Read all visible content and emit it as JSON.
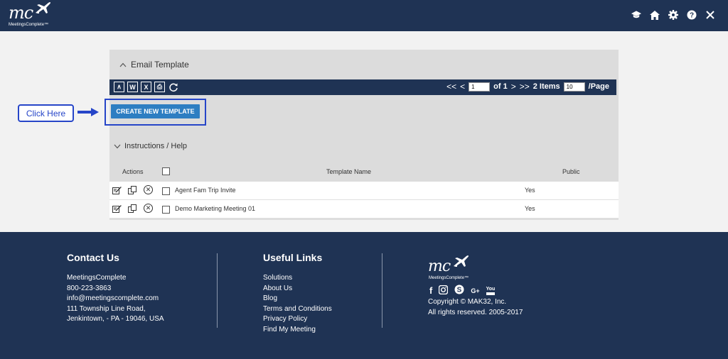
{
  "brand": {
    "logo_text": "mc",
    "logo_subtext": "MeetingsComplete™"
  },
  "header": {
    "icons": [
      "graduation-cap-icon",
      "home-icon",
      "gear-icon",
      "help-icon",
      "close-icon"
    ]
  },
  "panel": {
    "section_title": "Email Template",
    "toolbar": {
      "export_labels": {
        "pdf": "∧",
        "word": "W",
        "excel": "X",
        "print": "⎙"
      },
      "page_value": "1",
      "of_label": "of 1",
      "items_label": "2 Items",
      "per_page_value": "10",
      "per_page_label": "/Page"
    },
    "create_button": "CREATE NEW TEMPLATE",
    "instructions_label": "Instructions / Help",
    "table": {
      "headers": {
        "actions": "Actions",
        "name": "Template Name",
        "public": "Public"
      },
      "rows": [
        {
          "name": "Agent Fam Trip Invite",
          "public": "Yes"
        },
        {
          "name": "Demo Marketing Meeting 01",
          "public": "Yes"
        }
      ]
    }
  },
  "callout": {
    "label": "Click Here"
  },
  "footer": {
    "contact": {
      "title": "Contact Us",
      "lines": [
        "MeetingsComplete",
        "800-223-3863",
        "info@meetingscomplete.com",
        "111 Township Line Road,",
        "Jenkintown, - PA - 19046, USA"
      ]
    },
    "links": {
      "title": "Useful Links",
      "items": [
        "Solutions",
        "About Us",
        "Blog",
        "Terms and Conditions",
        "Privacy Policy",
        "Find My Meeting"
      ]
    },
    "social_icons": [
      "facebook-icon",
      "instagram-icon",
      "skype-icon",
      "google-plus-icon",
      "youtube-icon"
    ],
    "social_glyphs": {
      "facebook": "f",
      "google": "G+",
      "youtube": "You"
    },
    "copyright": [
      "Copyright © MAK32, Inc.",
      "All rights reserved. 2005-2017"
    ]
  },
  "colors": {
    "navy": "#1f3354",
    "button_blue": "#2d7ec2",
    "highlight_blue": "#2645c8"
  }
}
